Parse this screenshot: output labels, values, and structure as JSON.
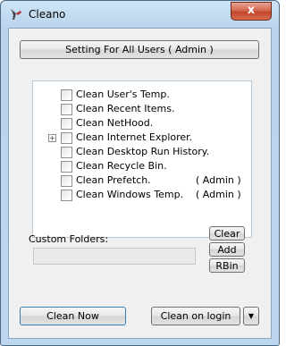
{
  "window": {
    "title": "Cleano",
    "close_label": "x"
  },
  "header_button": "Setting For All Users  ( Admin )",
  "items": [
    {
      "label": "Clean User's Temp.",
      "admin": "",
      "expandable": false
    },
    {
      "label": "Clean Recent Items.",
      "admin": "",
      "expandable": false
    },
    {
      "label": "Clean NetHood.",
      "admin": "",
      "expandable": false
    },
    {
      "label": "Clean Internet Explorer.",
      "admin": "",
      "expandable": true
    },
    {
      "label": "Clean Desktop Run History.",
      "admin": "",
      "expandable": false
    },
    {
      "label": "Clean Recycle Bin.",
      "admin": "",
      "expandable": false
    },
    {
      "label": "Clean Prefetch.",
      "admin": "( Admin )",
      "expandable": false
    },
    {
      "label": "Clean Windows Temp.",
      "admin": "( Admin )",
      "expandable": false
    }
  ],
  "expander_symbol": "+",
  "custom_folders": {
    "label": "Custom Folders:",
    "value": ""
  },
  "side_buttons": {
    "clear": "Clear",
    "add": "Add",
    "rbin": "RBin"
  },
  "footer": {
    "clean_now": "Clean  Now",
    "clean_on_login": "Clean on login",
    "dropdown_symbol": "▼"
  }
}
